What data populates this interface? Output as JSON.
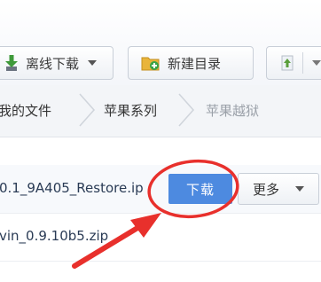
{
  "toolbar": {
    "offline_download": "离线下载",
    "new_folder": "新建目录",
    "icons": {
      "offline": "download-arrow-icon",
      "folder": "new-folder-icon",
      "upload": "upload-icon"
    },
    "colors": {
      "offline_icon": "#3f9a3a",
      "folder_icon": "#e9b43a",
      "folder_plus": "#39a345"
    }
  },
  "breadcrumb": {
    "items": [
      "我的文件",
      "苹果系列",
      "苹果越狱"
    ]
  },
  "files": [
    {
      "name": "0.1_9A405_Restore.ip"
    },
    {
      "name": "vin_0.9.10b5.zip"
    }
  ],
  "actions": {
    "download": "下载",
    "more": "更多"
  },
  "colors": {
    "download_button": "#4d8ae0",
    "annotation": "#e8302c"
  }
}
